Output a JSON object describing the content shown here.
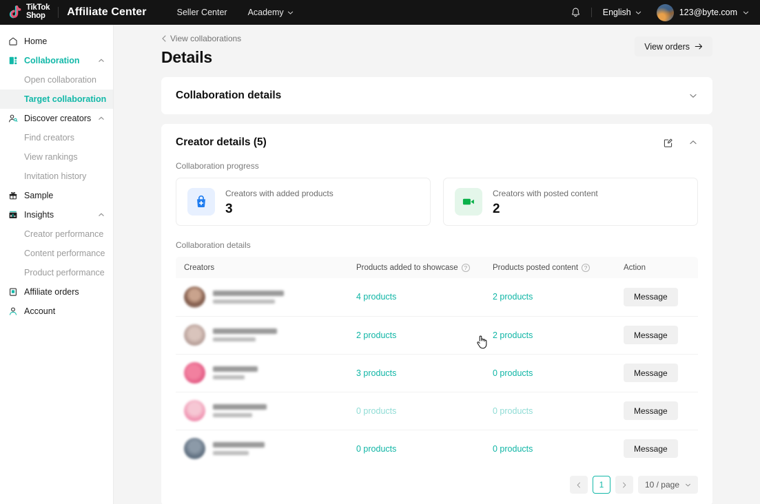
{
  "topbar": {
    "logo_line1": "TikTok",
    "logo_line2": "Shop",
    "brand": "Affiliate Center",
    "nav": [
      {
        "label": "Seller Center",
        "caret": false,
        "icon": ""
      },
      {
        "label": "Academy",
        "caret": true,
        "icon": "chevron-down-icon"
      }
    ],
    "bell_icon": "notification-bell-icon",
    "language": "English",
    "language_caret_icon": "chevron-down-icon",
    "user_email": "123@byte.com",
    "user_caret_icon": "chevron-down-icon",
    "avatar_icon": "user-avatar"
  },
  "sidebar": {
    "items": [
      {
        "label": "Home",
        "icon": "home-icon",
        "type": "item",
        "caret": false,
        "accent": false
      },
      {
        "label": "Collaboration",
        "icon": "collaboration-icon",
        "type": "item",
        "caret": true,
        "accent": true
      },
      {
        "label": "Open collaboration",
        "type": "sub",
        "active": false
      },
      {
        "label": "Target collaboration",
        "type": "sub",
        "active": true
      },
      {
        "label": "Discover creators",
        "icon": "discover-creators-icon",
        "type": "item",
        "caret": true,
        "accent": false
      },
      {
        "label": "Find creators",
        "type": "sub",
        "active": false
      },
      {
        "label": "View rankings",
        "type": "sub",
        "active": false
      },
      {
        "label": "Invitation history",
        "type": "sub",
        "active": false
      },
      {
        "label": "Sample",
        "icon": "gift-icon",
        "type": "item",
        "caret": false,
        "accent": false
      },
      {
        "label": "Insights",
        "icon": "insights-chart-icon",
        "type": "item",
        "caret": true,
        "accent": false
      },
      {
        "label": "Creator performance",
        "type": "sub",
        "active": false
      },
      {
        "label": "Content performance",
        "type": "sub",
        "active": false
      },
      {
        "label": "Product performance",
        "type": "sub",
        "active": false
      },
      {
        "label": "Affiliate orders",
        "icon": "clipboard-icon",
        "type": "item",
        "caret": false,
        "accent": false
      },
      {
        "label": "Account",
        "icon": "account-person-icon",
        "type": "item",
        "caret": false,
        "accent": false
      }
    ]
  },
  "page": {
    "breadcrumb": "View collaborations",
    "breadcrumb_icon": "chevron-left-icon",
    "title": "Details",
    "view_orders_label": "View orders",
    "view_orders_icon": "arrow-right-icon"
  },
  "collaboration_details_card": {
    "title": "Collaboration details",
    "toggle_icon": "chevron-down-icon"
  },
  "creator_details_card": {
    "title": "Creator details (5)",
    "edit_icon": "edit-square-icon",
    "toggle_icon": "chevron-up-icon",
    "progress_label": "Collaboration progress",
    "stats": [
      {
        "label": "Creators with added products",
        "value": "3",
        "icon": "bag-plus-icon",
        "color": "#1e7cf0",
        "bg": "#e7f0ff"
      },
      {
        "label": "Creators with posted content",
        "value": "2",
        "icon": "video-camera-icon",
        "color": "#0ab14a",
        "bg": "#e4f6ea"
      }
    ],
    "table_label": "Collaboration details",
    "columns": [
      {
        "label": "Creators",
        "help": false
      },
      {
        "label": "Products added to showcase",
        "help": true,
        "help_icon": "question-circle-icon"
      },
      {
        "label": "Products posted content",
        "help": true,
        "help_icon": "question-circle-icon"
      },
      {
        "label": "Action",
        "help": false
      }
    ],
    "rows": [
      {
        "avatar": "av1",
        "name_redacted": true,
        "name_width": 103,
        "handle_width": 90,
        "added": "4 products",
        "posted": "2 products",
        "faded": false,
        "action": "Message"
      },
      {
        "avatar": "av2",
        "name_redacted": true,
        "name_width": 93,
        "handle_width": 62,
        "added": "2 products",
        "posted": "2 products",
        "faded": false,
        "action": "Message"
      },
      {
        "avatar": "av3",
        "name_redacted": true,
        "name_width": 65,
        "handle_width": 46,
        "added": "3 products",
        "posted": "0 products",
        "faded": false,
        "action": "Message"
      },
      {
        "avatar": "av4",
        "name_redacted": true,
        "name_width": 78,
        "handle_width": 57,
        "added": "0 products",
        "posted": "0 products",
        "faded": true,
        "action": "Message"
      },
      {
        "avatar": "av5",
        "name_redacted": true,
        "name_width": 75,
        "handle_width": 52,
        "added": "0 products",
        "posted": "0 products",
        "faded": false,
        "action": "Message"
      }
    ],
    "pagination": {
      "prev_icon": "chevron-left-icon",
      "current_page": "1",
      "next_icon": "chevron-right-icon",
      "page_size": "10 / page",
      "page_size_icon": "chevron-down-icon"
    }
  },
  "colors": {
    "accent": "#12b8a8",
    "link": "#0fb5a5",
    "topbar_bg": "#141414",
    "page_bg": "#f4f4f4"
  }
}
